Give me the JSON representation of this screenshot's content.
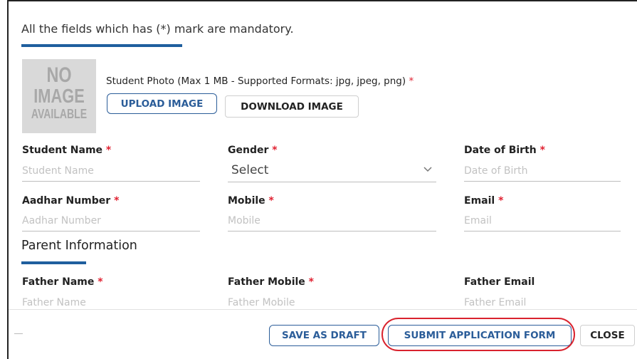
{
  "form": {
    "mandatory_note": "All the fields which has (*) mark are mandatory.",
    "photo": {
      "placeholder_lines": [
        "NO",
        "IMAGE",
        "AVAILABLE"
      ],
      "label": "Student Photo (Max 1 MB - Supported Formats: jpg, jpeg, png)",
      "required_mark": "*",
      "upload_button": "UPLOAD IMAGE",
      "download_button": "DOWNLOAD IMAGE"
    },
    "fields": {
      "student_name": {
        "label": "Student Name",
        "required": "*",
        "placeholder": "Student Name"
      },
      "gender": {
        "label": "Gender",
        "required": "*",
        "value": "Select"
      },
      "dob": {
        "label": "Date of Birth",
        "required": "*",
        "placeholder": "Date of Birth"
      },
      "aadhar": {
        "label": "Aadhar Number",
        "required": "*",
        "placeholder": "Aadhar Number"
      },
      "mobile": {
        "label": "Mobile",
        "required": "*",
        "placeholder": "Mobile"
      },
      "email": {
        "label": "Email",
        "required": "*",
        "placeholder": "Email"
      }
    },
    "parent_section": {
      "title": "Parent Information",
      "father_name": {
        "label": "Father Name",
        "required": "*",
        "placeholder": "Father Name"
      },
      "father_mobile": {
        "label": "Father Mobile",
        "required": "*",
        "placeholder": "Father Mobile"
      },
      "father_email": {
        "label": "Father Email",
        "placeholder": "Father Email"
      }
    }
  },
  "footer": {
    "save_draft": "SAVE AS DRAFT",
    "submit": "SUBMIT APPLICATION FORM",
    "close": "CLOSE"
  },
  "colors": {
    "accent": "#1f5f9e",
    "required": "#e02030",
    "highlight": "#d9232e"
  }
}
